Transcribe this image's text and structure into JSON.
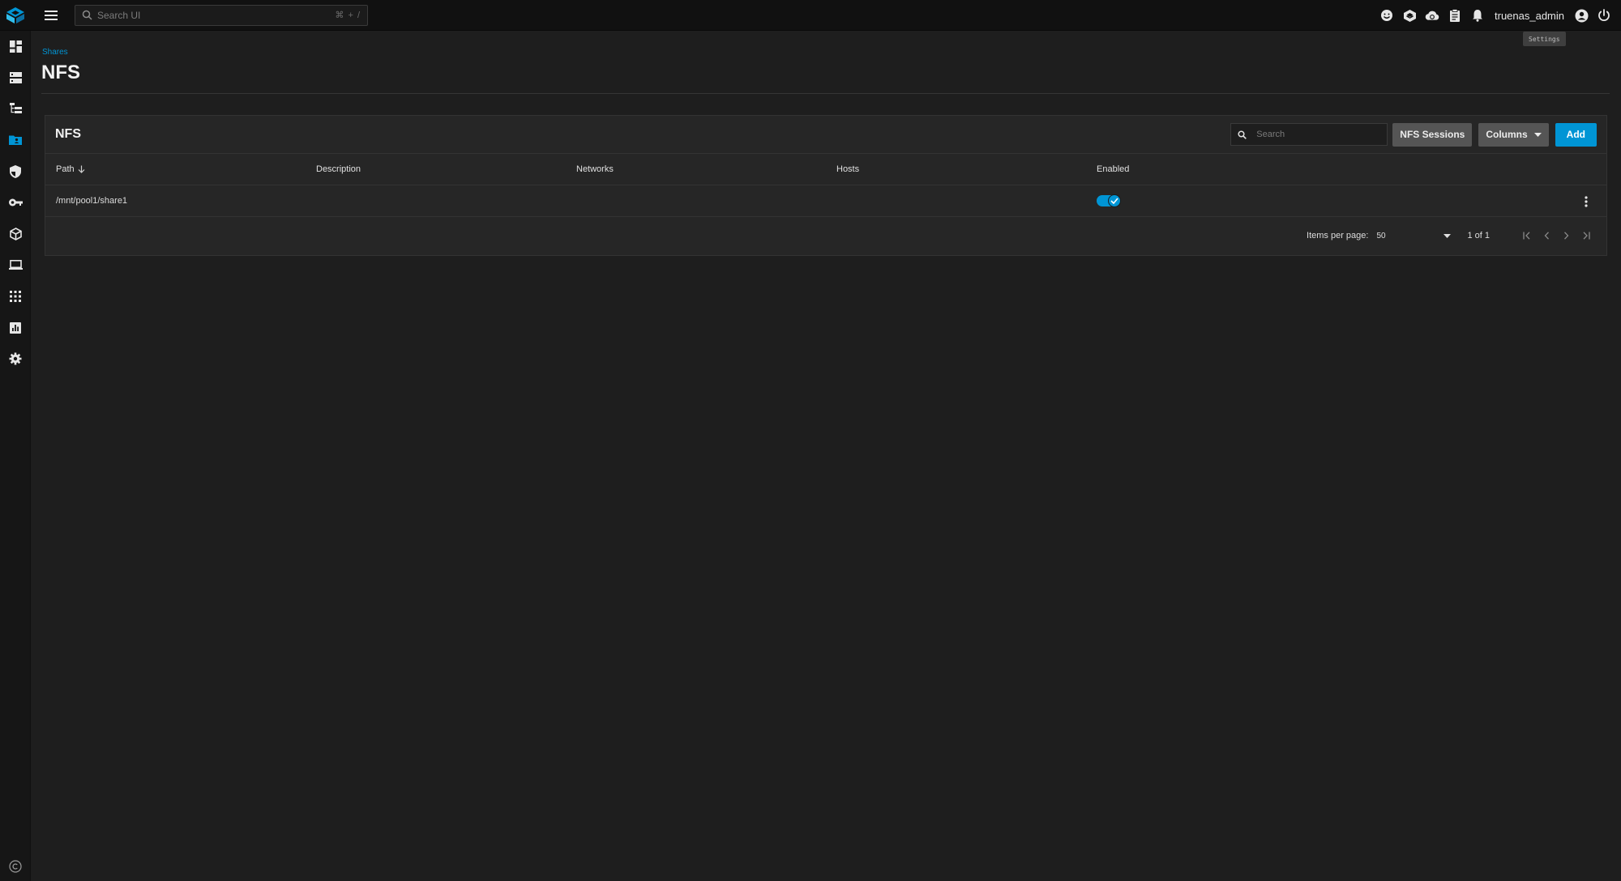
{
  "header": {
    "search_placeholder": "Search UI",
    "search_shortcut": "⌘ + /",
    "username": "truenas_admin",
    "tooltip": "Settings"
  },
  "sidebar": {
    "items": [
      {
        "icon": "dashboard-icon",
        "active": false
      },
      {
        "icon": "storage-icon",
        "active": false
      },
      {
        "icon": "datasets-icon",
        "active": false
      },
      {
        "icon": "shares-icon",
        "active": true
      },
      {
        "icon": "data-protection-icon",
        "active": false
      },
      {
        "icon": "credentials-icon",
        "active": false
      },
      {
        "icon": "apps-icon",
        "active": false
      },
      {
        "icon": "virtualization-icon",
        "active": false
      },
      {
        "icon": "system-apps-grid-icon",
        "active": false
      },
      {
        "icon": "reporting-icon",
        "active": false
      },
      {
        "icon": "system-settings-icon",
        "active": false
      }
    ]
  },
  "page": {
    "breadcrumb": "Shares",
    "title": "NFS"
  },
  "card": {
    "title": "NFS",
    "search_placeholder": "Search",
    "sessions_label": "NFS Sessions",
    "columns_label": "Columns",
    "add_label": "Add"
  },
  "table": {
    "headers": {
      "path": "Path",
      "description": "Description",
      "networks": "Networks",
      "hosts": "Hosts",
      "enabled": "Enabled"
    },
    "rows": [
      {
        "path": "/mnt/pool1/share1",
        "description": "",
        "networks": "",
        "hosts": "",
        "enabled": true
      }
    ]
  },
  "paginator": {
    "items_per_page_label": "Items per page:",
    "items_per_page": "50",
    "range": "1 of 1"
  },
  "colors": {
    "accent": "#0095d5",
    "background": "#1e1e1e",
    "topbar": "#111111",
    "card": "#262626"
  }
}
